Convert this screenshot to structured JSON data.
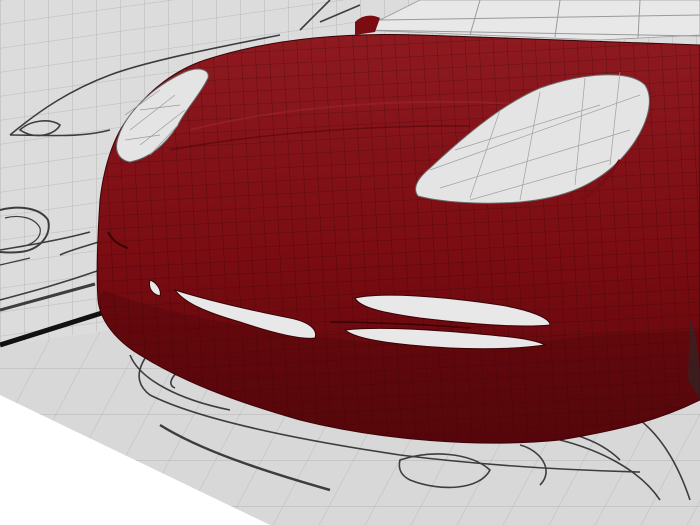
{
  "viewport": {
    "scene": "3d-modeling-viewport",
    "mode": "wireframe-on-shaded"
  },
  "colors": {
    "background": "#ffffff",
    "side_plane": "#dcdcdc",
    "floor_plane": "#d8d8d8",
    "grid_line": "#b0b0b0",
    "body_paint": "#7a0c12",
    "body_highlight": "#8e1a20",
    "body_shadow": "#4e060a",
    "wire": "#2a0204",
    "sketch_line": "#222222",
    "headlight_glass": "#e4e4e4",
    "floor_edge": "#111111"
  },
  "icons": {
    "model": "car-front-model-icon",
    "blueprint_side": "side-blueprint-icon",
    "blueprint_front": "front-blueprint-icon"
  }
}
